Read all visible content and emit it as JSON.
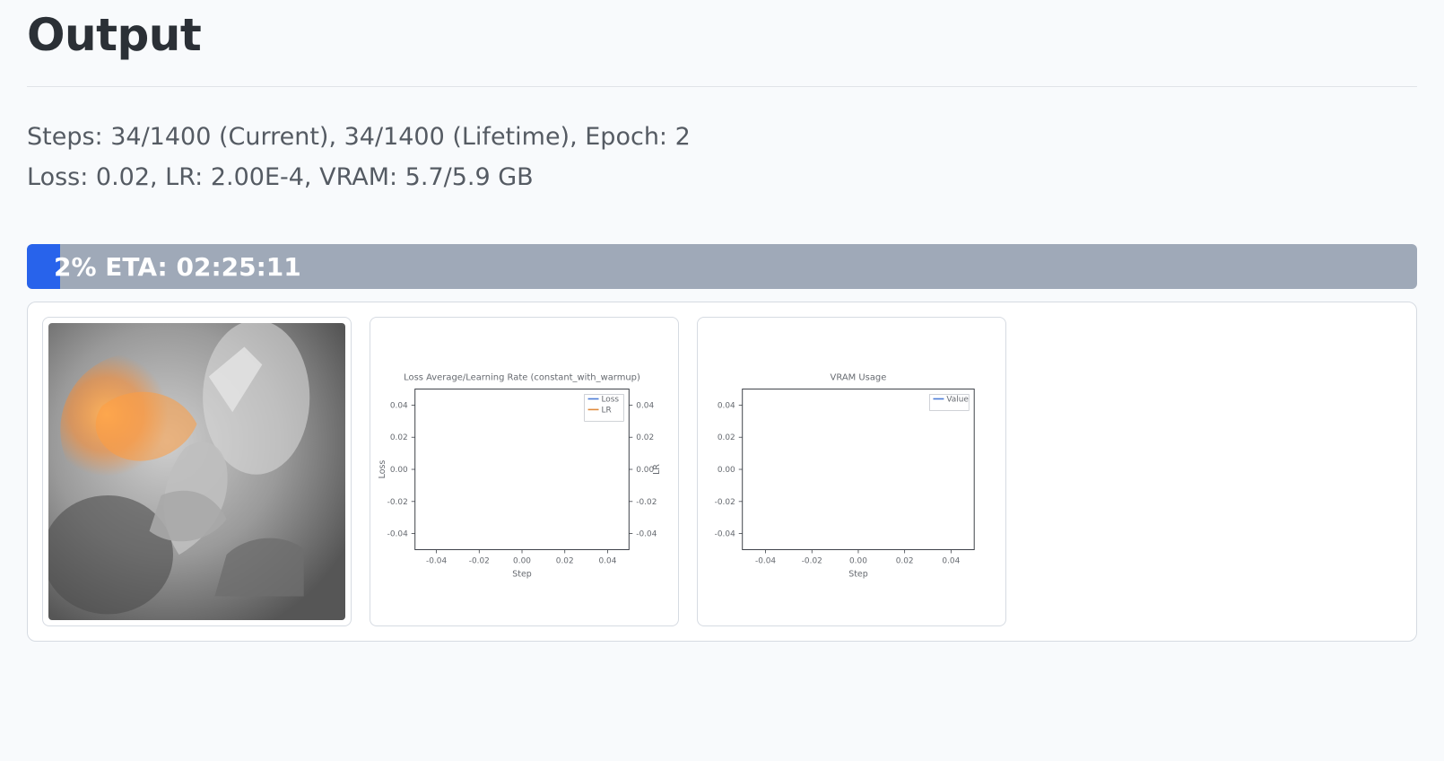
{
  "header": {
    "title": "Output"
  },
  "status": {
    "line1": "Steps: 34/1400 (Current), 34/1400 (Lifetime), Epoch: 2",
    "line2": "Loss: 0.02, LR: 2.00E-4, VRAM: 5.7/5.9 GB"
  },
  "progress": {
    "percent": 2,
    "label": "2% ETA: 02:25:11",
    "fill_color": "#2863eb",
    "track_color": "#9fa9b8"
  },
  "gallery": {
    "preview": {
      "desc": "sample-output-image"
    }
  },
  "chart_data": [
    {
      "type": "line",
      "title": "Loss Average/Learning Rate (constant_with_warmup)",
      "xlabel": "Step",
      "ylabel_left": "Loss",
      "ylabel_right": "LR",
      "x_ticks": [
        -0.04,
        -0.02,
        0.0,
        0.02,
        0.04
      ],
      "y_ticks": [
        -0.04,
        -0.02,
        0.0,
        0.02,
        0.04
      ],
      "xlim": [
        -0.05,
        0.05
      ],
      "ylim": [
        -0.05,
        0.05
      ],
      "series": [
        {
          "name": "Loss",
          "color": "#4b7bd6",
          "x": [],
          "y": []
        },
        {
          "name": "LR",
          "color": "#e08a3c",
          "x": [],
          "y": []
        }
      ]
    },
    {
      "type": "line",
      "title": "VRAM Usage",
      "xlabel": "Step",
      "ylabel_left": "",
      "x_ticks": [
        -0.04,
        -0.02,
        0.0,
        0.02,
        0.04
      ],
      "y_ticks": [
        -0.04,
        -0.02,
        0.0,
        0.02,
        0.04
      ],
      "xlim": [
        -0.05,
        0.05
      ],
      "ylim": [
        -0.05,
        0.05
      ],
      "series": [
        {
          "name": "Value",
          "color": "#4b7bd6",
          "x": [],
          "y": []
        }
      ]
    }
  ]
}
